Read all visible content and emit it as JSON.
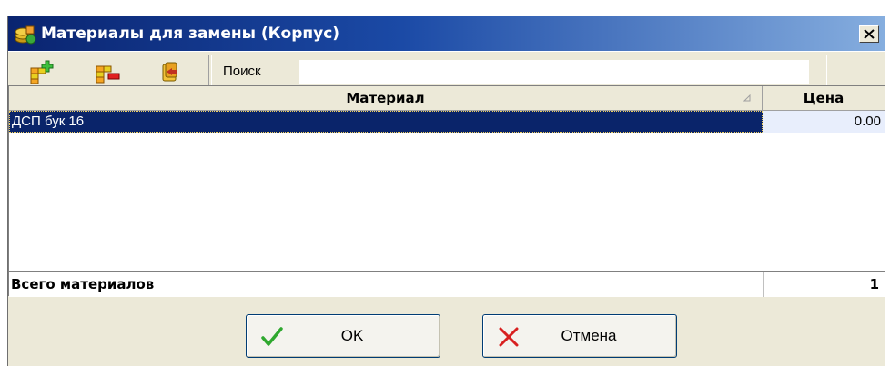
{
  "window": {
    "title": "Материалы для замены (Корпус)",
    "close_label": "x"
  },
  "toolbar": {
    "search_label": "Поиск",
    "search_value": ""
  },
  "grid": {
    "columns": [
      "Материал",
      "Цена"
    ],
    "rows": [
      {
        "material": "ДСП бук 16",
        "price": "0.00",
        "selected": true
      }
    ],
    "footer": {
      "label": "Всего материалов",
      "count": "1"
    }
  },
  "buttons": {
    "ok_label": "OK",
    "cancel_label": "Отмена"
  },
  "colors": {
    "title_gradient_start": "#0a2470",
    "title_gradient_end": "#86aedf",
    "selection": "#0a246a",
    "window_bg": "#ece9d8"
  },
  "icons": {
    "app": "materials-coins-icon",
    "add": "add-material-icon",
    "remove": "remove-material-icon",
    "replace": "replace-material-icon",
    "ok": "checkmark-icon",
    "cancel": "cross-icon",
    "sort": "sort-indicator-icon"
  }
}
